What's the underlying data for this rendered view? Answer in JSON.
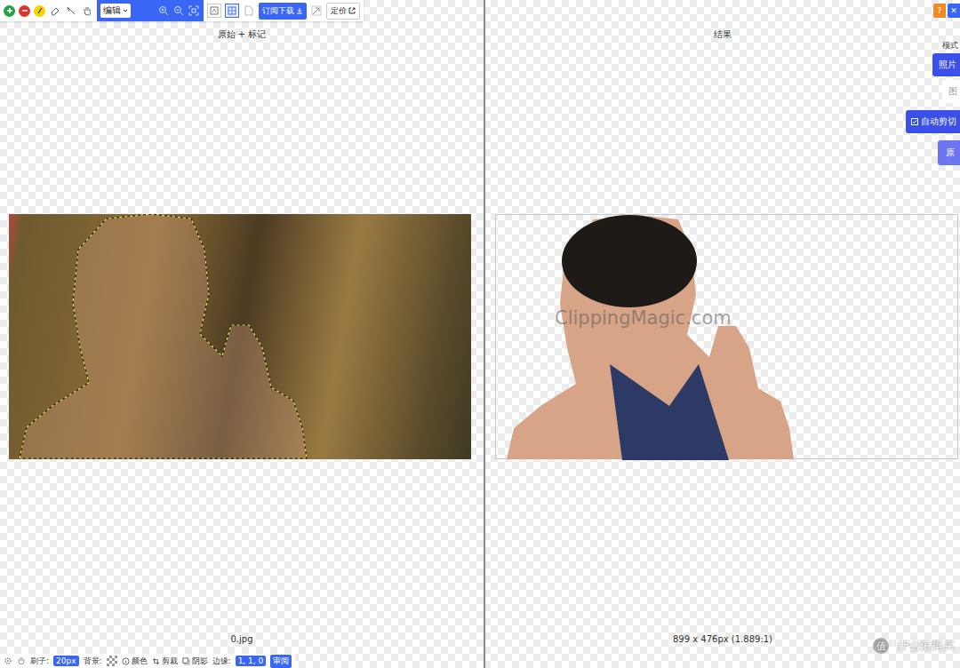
{
  "toolbar": {
    "mode": "编辑",
    "views": [
      {
        "selected": false
      },
      {
        "selected": true
      }
    ],
    "subscribe_button": "订阅下载",
    "pricing_button": "定价"
  },
  "left_panel": {
    "title": "原始 + 标记",
    "filename": "0.jpg"
  },
  "bottom_bar": {
    "brush_label": "刷子:",
    "brush_size": "20px",
    "background_label": "背景:",
    "actions": [
      "颜色",
      "剪裁",
      "阴影"
    ],
    "edge_label": "边缘:",
    "edge_value": "1, 1, 0",
    "review_button": "审阅"
  },
  "right_panel": {
    "title": "结果",
    "watermark": "ClippingMagic.com",
    "dimensions": "899 x 476px (1.889:1)"
  },
  "side_controls": {
    "help": "?",
    "close": "✕",
    "mode_label": "模式",
    "mode_options": [
      {
        "label": "照片",
        "selected": true
      },
      {
        "label": "图",
        "selected": false
      }
    ],
    "auto_clip": {
      "label": "自动剪切",
      "checked": true
    },
    "original_button": "原"
  },
  "site_watermark": {
    "logo": "值",
    "text": "什么值得买"
  }
}
